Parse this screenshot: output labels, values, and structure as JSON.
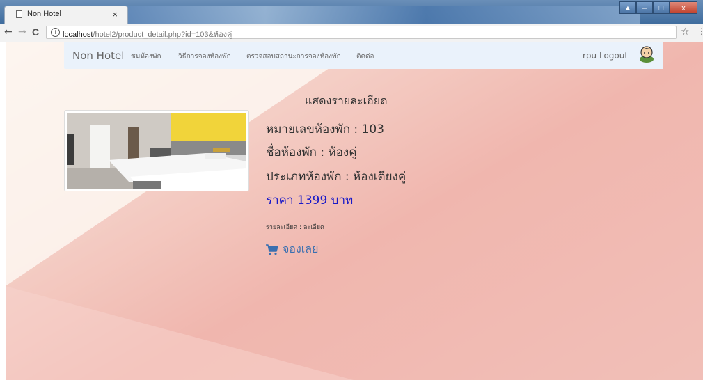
{
  "browser": {
    "tab_title": "Non Hotel",
    "tab_close": "×",
    "url_host": "localhost",
    "url_path": "/hotel2/product_detail.php?id=103&ห้องคู่",
    "back": "←",
    "forward": "→",
    "reload": "C",
    "info": "i",
    "star": "☆",
    "menu": "⋮"
  },
  "navbar": {
    "brand": "Non Hotel",
    "items": [
      "ชมห้องพัก",
      "วิธีการจองห้องพัก",
      "ตรวจสอบสถานะการจองห้องพัก",
      "ติดต่อ"
    ],
    "user_logout": "rpu Logout",
    "avatar_icon": "user-avatar-icon"
  },
  "detail": {
    "heading": "แสดงรายละเอียด",
    "room_number": "หมายเลขห้องพัก : 103",
    "room_name": "ชื่อห้องพัก : ห้องคู่",
    "room_type": "ประเภทห้องพัก : ห้องเตียงคู่",
    "price": "ราคา 1399 บาท",
    "description": "รายละเอียด : ละเอียด",
    "book_label": "จองเลย",
    "cart_icon": "cart-icon"
  },
  "colors": {
    "price": "#1a1ac8",
    "book": "#3a6fb0",
    "navbar_bg": "#eaf2fb"
  }
}
